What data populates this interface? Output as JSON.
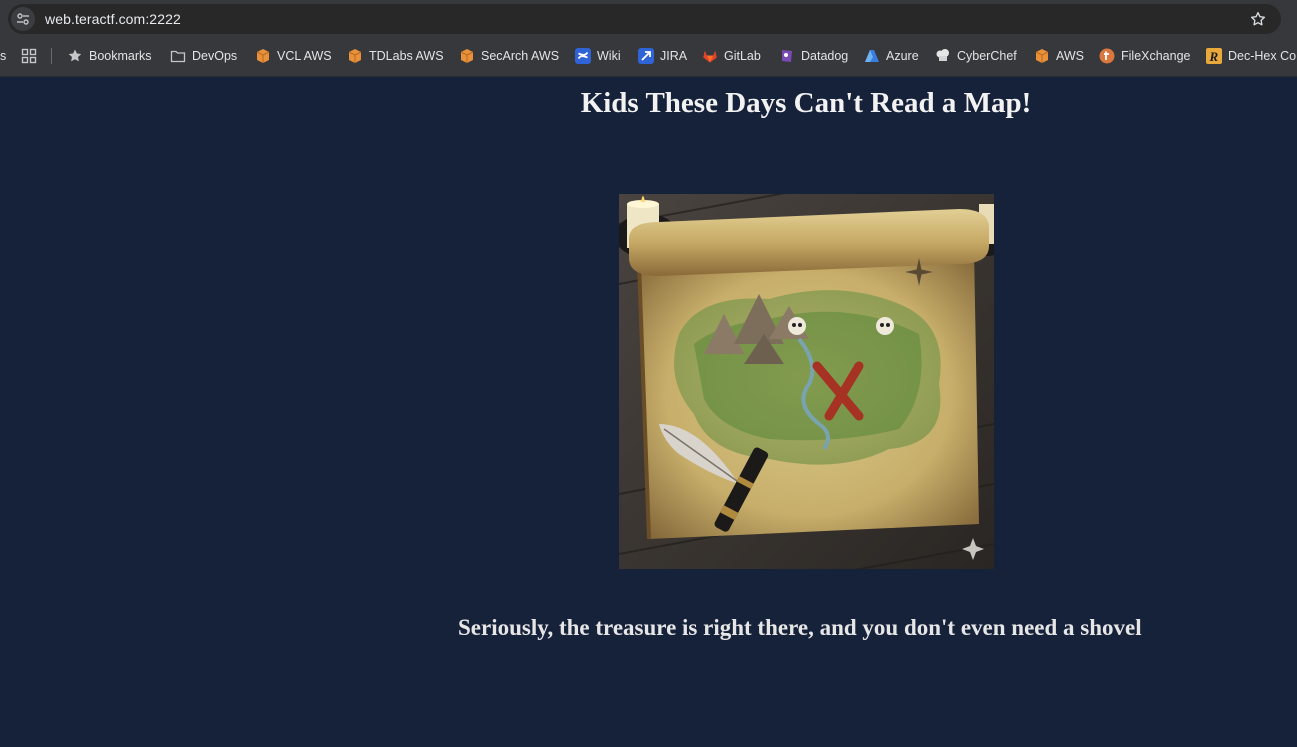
{
  "browser": {
    "url": "web.teractf.com:2222",
    "bookmarks": [
      {
        "label": "s",
        "icon": "truncated-item"
      },
      {
        "label": "",
        "icon": "apps-grid-icon"
      },
      {
        "label": "Bookmarks",
        "icon": "star-icon"
      },
      {
        "label": "DevOps",
        "icon": "folder-icon"
      },
      {
        "label": "VCL AWS",
        "icon": "aws-cube-icon"
      },
      {
        "label": "TDLabs AWS",
        "icon": "aws-cube-icon"
      },
      {
        "label": "SecArch AWS",
        "icon": "aws-cube-icon"
      },
      {
        "label": "Wiki",
        "icon": "confluence-icon"
      },
      {
        "label": "JIRA",
        "icon": "jira-icon"
      },
      {
        "label": "GitLab",
        "icon": "gitlab-icon"
      },
      {
        "label": "Datadog",
        "icon": "datadog-icon"
      },
      {
        "label": "Azure",
        "icon": "azure-icon"
      },
      {
        "label": "CyberChef",
        "icon": "chef-hat-icon"
      },
      {
        "label": "AWS",
        "icon": "aws-cube-icon"
      },
      {
        "label": "FileXchange",
        "icon": "filexchange-icon"
      },
      {
        "label": "Dec-Hex Co",
        "icon": "r-icon"
      }
    ]
  },
  "page": {
    "title": "Kids These Days Can't Read a Map!",
    "subtitle": "Seriously, the treasure is right there, and you don't even need a shovel"
  },
  "colors": {
    "page_background": "#16213a",
    "chrome_background": "#37383c",
    "text": "#f2f2f2"
  }
}
